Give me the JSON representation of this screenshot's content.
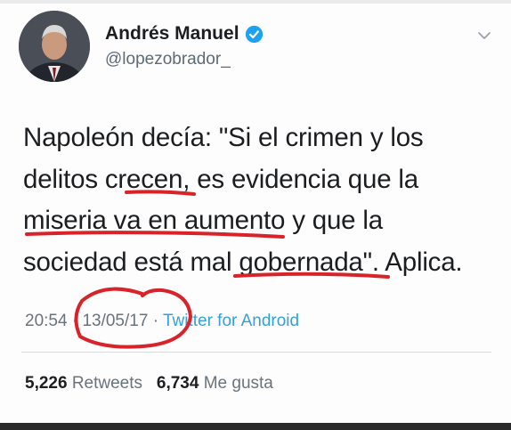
{
  "header": {
    "display_name": "Andrés Manuel",
    "handle": "@lopezobrador_",
    "verified": true
  },
  "tweet": {
    "lines": [
      "Napoleón decía: \"Si el crimen y los",
      "delitos crecen, es evidencia que la",
      "miseria va en aumento y que la",
      "sociedad está mal gobernada\". Aplica."
    ]
  },
  "meta": {
    "time": "20:54",
    "separator": "·",
    "date": "13/05/17",
    "source": "Twitter for Android"
  },
  "stats": {
    "retweets_count": "5,226",
    "retweets_label": "Retweets",
    "likes_count": "6,734",
    "likes_label": "Me gusta"
  },
  "colors": {
    "verified": "#1da1f2",
    "link": "#33a1d8",
    "annotation_red": "#d8232a"
  },
  "icons": [
    "verified-badge-icon",
    "chevron-down-icon"
  ]
}
